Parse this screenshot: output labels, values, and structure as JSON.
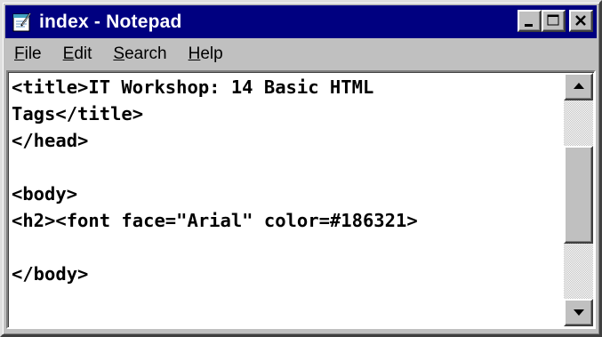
{
  "window": {
    "title": "index - Notepad",
    "icon": "notepad-icon",
    "colors": {
      "titlebar": "#000080",
      "face": "#c0c0c0"
    }
  },
  "title_buttons": {
    "minimize": "minimize-icon",
    "maximize": "maximize-icon",
    "close": "close-icon"
  },
  "menu": {
    "items": [
      {
        "accel": "F",
        "rest": "ile"
      },
      {
        "accel": "E",
        "rest": "dit"
      },
      {
        "accel": "S",
        "rest": "earch"
      },
      {
        "accel": "H",
        "rest": "elp"
      }
    ]
  },
  "editor": {
    "lines": [
      "<title>IT Workshop: 14 Basic HTML",
      "Tags</title>",
      "</head>",
      "",
      "<body>",
      "<h2><font face=\"Arial\" color=#186321>",
      "",
      "</body>"
    ]
  },
  "scrollbar": {
    "position": 0.45
  }
}
